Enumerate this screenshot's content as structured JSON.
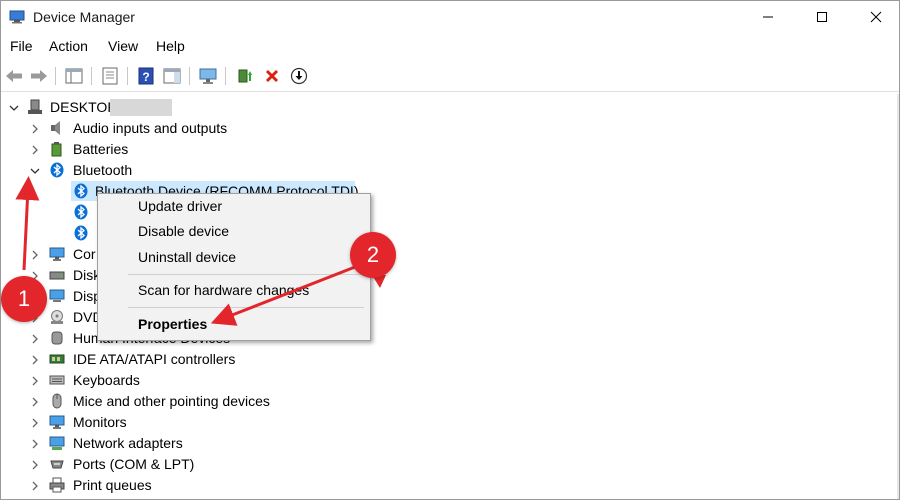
{
  "window": {
    "title": "Device Manager"
  },
  "menu": [
    "File",
    "Action",
    "View",
    "Help"
  ],
  "tree": {
    "root": "DESKTOP-",
    "categories": {
      "audio": "Audio inputs and outputs",
      "batteries": "Batteries",
      "bluetooth": "Bluetooth",
      "computer": "Cor",
      "disk": "Disk",
      "display": "Disp",
      "dvd": "DVD",
      "hid": "Human Interface Devices",
      "ide": "IDE ATA/ATAPI controllers",
      "keyboards": "Keyboards",
      "mice": "Mice and other pointing devices",
      "monitors": "Monitors",
      "network": "Network adapters",
      "ports": "Ports (COM & LPT)",
      "print": "Print queues"
    },
    "bluetooth_child": "Bluetooth Device (RFCOMM Protocol TDI)"
  },
  "context_menu": {
    "update": "Update driver",
    "disable": "Disable device",
    "uninstall": "Uninstall device",
    "scan": "Scan for hardware changes",
    "properties": "Properties"
  },
  "annotations": {
    "one": "1",
    "two": "2"
  },
  "colors": {
    "accent": "#e2262c",
    "selection": "#cce8ff",
    "bluetooth": "#0a6fd6"
  }
}
